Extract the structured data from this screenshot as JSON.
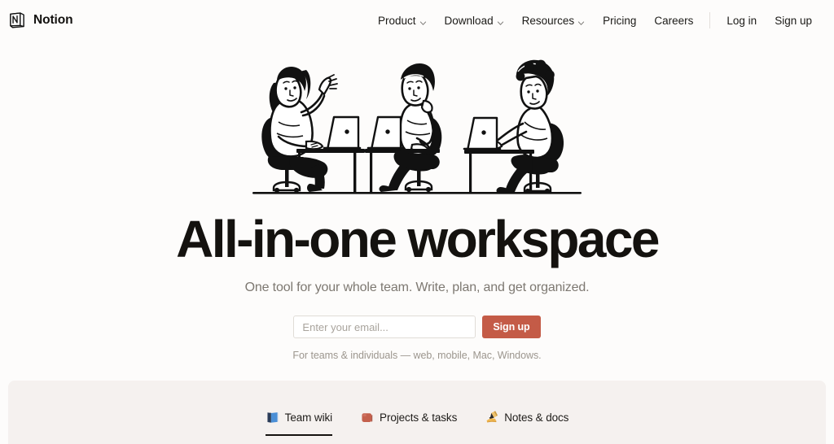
{
  "header": {
    "brand": {
      "logo_icon": "notion-logo-icon",
      "name": "Notion"
    },
    "nav": [
      {
        "label": "Product",
        "has_dropdown": true,
        "icon": "chevron-down-icon"
      },
      {
        "label": "Download",
        "has_dropdown": true,
        "icon": "chevron-down-icon"
      },
      {
        "label": "Resources",
        "has_dropdown": true,
        "icon": "chevron-down-icon"
      },
      {
        "label": "Pricing",
        "has_dropdown": false,
        "icon": ""
      },
      {
        "label": "Careers",
        "has_dropdown": false,
        "icon": ""
      }
    ],
    "auth": [
      {
        "label": "Log in"
      },
      {
        "label": "Sign up"
      }
    ]
  },
  "hero": {
    "illustration_name": "three-people-at-desks-with-laptops-illustration",
    "headline": "All-in-one workspace",
    "subhead": "One tool for your whole team. Write, plan, and get organized.",
    "form": {
      "email_placeholder": "Enter your email...",
      "email_value": "",
      "submit_label": "Sign up",
      "note": "For teams & individuals — web, mobile, Mac, Windows."
    }
  },
  "feature_tabs": [
    {
      "label": "Team wiki",
      "emoji": "blue-book-emoji",
      "active": true
    },
    {
      "label": "Projects & tasks",
      "emoji": "brick-emoji",
      "active": false
    },
    {
      "label": "Notes & docs",
      "emoji": "writing-hand-emoji",
      "active": false
    }
  ],
  "colors": {
    "page_background": "#FDFCFB",
    "panel_background": "#F5F1EF",
    "accent_button": "#C45B47",
    "text_primary": "#14120F",
    "text_muted": "#7D7871"
  }
}
